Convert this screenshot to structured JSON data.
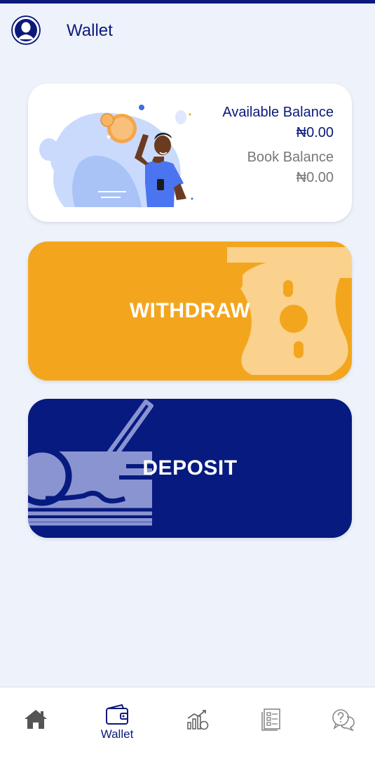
{
  "header": {
    "title": "Wallet",
    "avatar_icon": "user-avatar-icon"
  },
  "balances": {
    "available_label": "Available Balance",
    "available_value": "₦0.00",
    "book_label": "Book Balance",
    "book_value": "₦0.00"
  },
  "actions": {
    "withdraw_label": "WITHDRAW",
    "deposit_label": "DEPOSIT"
  },
  "bottom_nav": {
    "items": [
      {
        "icon": "home-icon",
        "label": ""
      },
      {
        "icon": "wallet-icon",
        "label": "Wallet",
        "active": true
      },
      {
        "icon": "chart-growth-icon",
        "label": ""
      },
      {
        "icon": "document-list-icon",
        "label": ""
      },
      {
        "icon": "help-chat-icon",
        "label": ""
      }
    ]
  },
  "colors": {
    "brand_navy": "#0b1a7a",
    "withdraw_orange": "#f3a61d",
    "deposit_navy": "#061a80",
    "background": "#eef2fa"
  }
}
